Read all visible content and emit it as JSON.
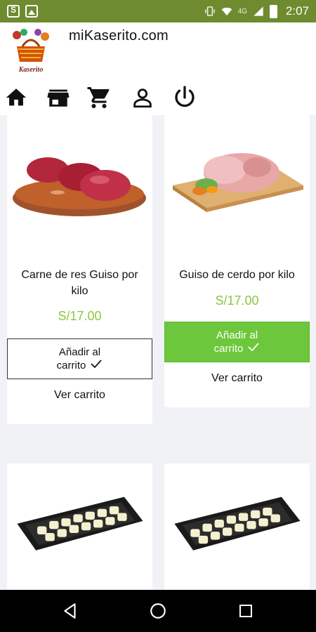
{
  "status_bar": {
    "network": "4G",
    "time": "2:07",
    "icons": [
      "s-notification-icon",
      "photo-icon",
      "vibrate-icon",
      "wifi-icon",
      "signal-icon",
      "battery-icon"
    ]
  },
  "header": {
    "title": "miKaserito.com",
    "logo_text": "Kaserito"
  },
  "nav": {
    "icons": [
      "home-icon",
      "store-icon",
      "cart-icon",
      "user-icon",
      "power-icon"
    ]
  },
  "products": [
    {
      "name": "Carne de res Guiso por kilo",
      "price": "S/17.00",
      "add_label_line1": "Añadir al",
      "add_label_line2": "carrito",
      "view_cart": "Ver carrito"
    },
    {
      "name": "Guiso de cerdo por kilo",
      "price": "S/17.00",
      "add_label_line1": "Añadir al",
      "add_label_line2": "carrito",
      "view_cart": "Ver carrito"
    }
  ],
  "colors": {
    "accent": "#8cc63f",
    "green_button": "#6dc73c",
    "status_bar": "#6f8b2f"
  }
}
